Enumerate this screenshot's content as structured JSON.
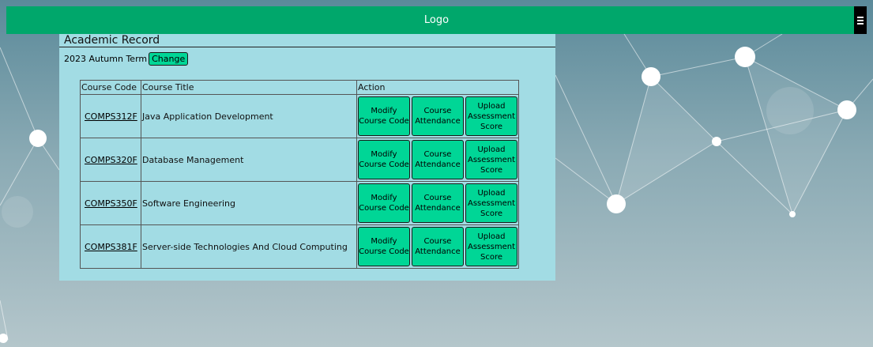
{
  "header": {
    "logo": "Logo",
    "menu_icon": "hamburger-menu-icon"
  },
  "page": {
    "title": "Academic Record"
  },
  "term": {
    "label": "2023 Autumn Term",
    "change_label": "Change"
  },
  "table": {
    "headers": [
      "Course Code",
      "Course Title",
      "Action"
    ],
    "rows": [
      {
        "code": "COMPS312F",
        "title": "Java Application Development",
        "actions": [
          "Modify Course Code",
          "Course Attendance",
          "Upload Assessment Score"
        ]
      },
      {
        "code": "COMPS320F",
        "title": "Database Management",
        "actions": [
          "Modify Course Code",
          "Course Attendance",
          "Upload Assessment Score"
        ]
      },
      {
        "code": "COMPS350F",
        "title": "Software Engineering",
        "actions": [
          "Modify Course Code",
          "Course Attendance",
          "Upload Assessment Score"
        ]
      },
      {
        "code": "COMPS381F",
        "title": "Server-side Technologies And Cloud Computing",
        "actions": [
          "Modify Course Code",
          "Course Attendance",
          "Upload Assessment Score"
        ]
      }
    ]
  },
  "colors": {
    "header_bg": "#00a76b",
    "panel_bg": "#a2dce4",
    "button_bg": "#00d696",
    "background": "#8aaab4"
  }
}
